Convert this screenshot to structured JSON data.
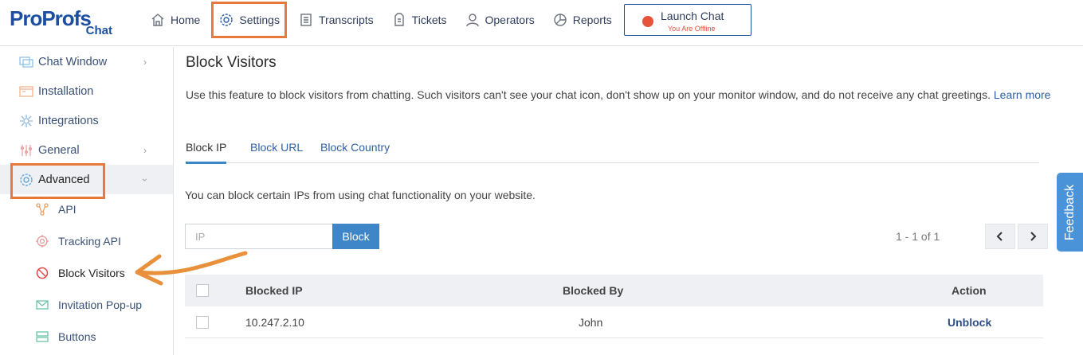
{
  "brand": {
    "name_part1": "Pro",
    "name_part2": "Profs",
    "sub": "Chat"
  },
  "nav": {
    "items": [
      {
        "label": "Home",
        "icon": "home-icon"
      },
      {
        "label": "Settings",
        "icon": "gear-icon",
        "active": true
      },
      {
        "label": "Transcripts",
        "icon": "document-icon"
      },
      {
        "label": "Tickets",
        "icon": "ticket-icon"
      },
      {
        "label": "Operators",
        "icon": "user-icon"
      },
      {
        "label": "Reports",
        "icon": "pie-chart-icon"
      }
    ],
    "launch_label": "Launch Chat",
    "launch_status": "You Are Offline"
  },
  "sidebar": {
    "items": [
      {
        "label": "Chat Window",
        "icon": "chat-window-icon"
      },
      {
        "label": "Installation",
        "icon": "installation-icon"
      },
      {
        "label": "Integrations",
        "icon": "integrations-icon"
      },
      {
        "label": "General",
        "icon": "sliders-icon"
      },
      {
        "label": "Advanced",
        "icon": "gear-icon"
      }
    ],
    "sub_items": [
      {
        "label": "API",
        "icon": "api-icon"
      },
      {
        "label": "Tracking API",
        "icon": "target-icon"
      },
      {
        "label": "Block Visitors",
        "icon": "block-icon"
      },
      {
        "label": "Invitation Pop-up",
        "icon": "mail-icon"
      },
      {
        "label": "Buttons",
        "icon": "buttons-icon"
      }
    ]
  },
  "main": {
    "title": "Block Visitors",
    "description": "Use this feature to block visitors from chatting. Such visitors can't see your chat icon, don't show up on your monitor window, and do not receive any chat greetings.",
    "learn_more": "Learn more",
    "tabs": [
      "Block IP",
      "Block URL",
      "Block Country"
    ],
    "info": "You can block certain IPs from using chat functionality on your website.",
    "ip_placeholder": "IP",
    "block_button": "Block",
    "pager": "1 - 1 of 1",
    "table": {
      "headers": [
        "Blocked IP",
        "Blocked By",
        "Action"
      ],
      "rows": [
        {
          "ip": "10.247.2.10",
          "by": "John",
          "action": "Unblock"
        }
      ]
    }
  },
  "feedback_label": "Feedback",
  "colors": {
    "accent": "#e8793b",
    "primary": "#3e86c8",
    "brand": "#1d4fa1",
    "offline": "#e8523b"
  }
}
